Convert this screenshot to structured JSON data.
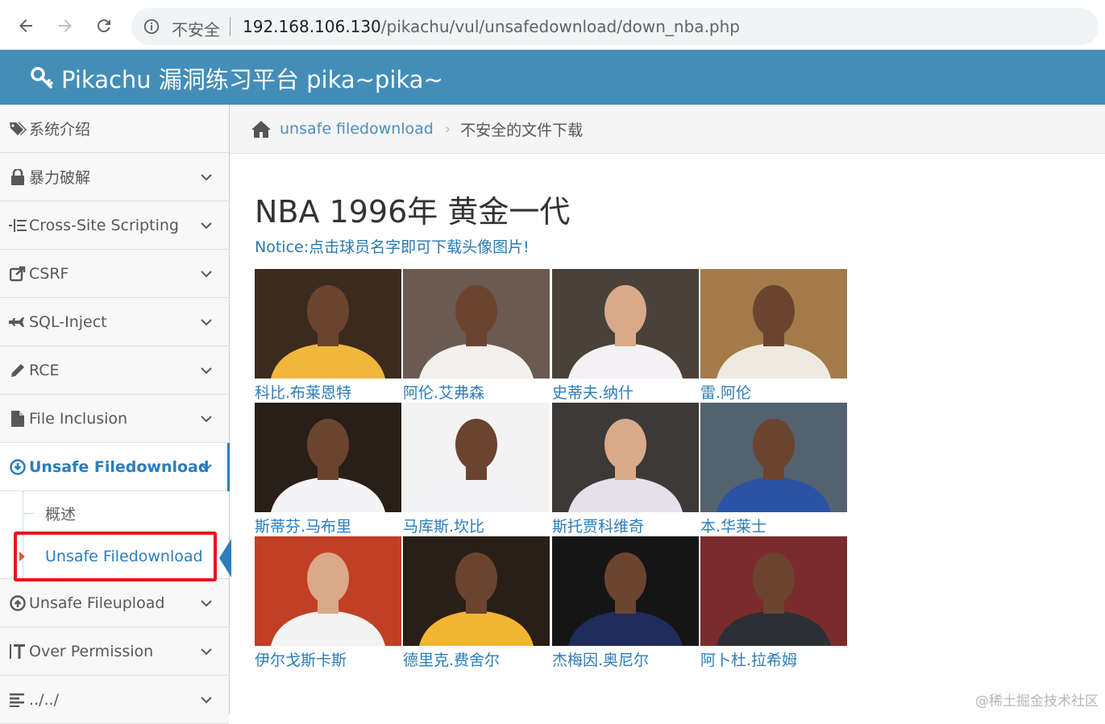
{
  "browser": {
    "insecure_label": "不安全",
    "url_host": "192.168.106.130",
    "url_path": "/pikachu/vul/unsafedownload/down_nba.php"
  },
  "header": {
    "title": "Pikachu 漏洞练习平台 pika~pika~"
  },
  "sidebar": {
    "items": [
      {
        "label": "系统介绍",
        "icon": "tags-icon"
      },
      {
        "label": "暴力破解",
        "icon": "lock-icon"
      },
      {
        "label": "Cross-Site Scripting",
        "icon": "list-icon"
      },
      {
        "label": "CSRF",
        "icon": "share-icon"
      },
      {
        "label": "SQL-Inject",
        "icon": "plane-icon"
      },
      {
        "label": "RCE",
        "icon": "pencil-icon"
      },
      {
        "label": "File Inclusion",
        "icon": "file-icon"
      },
      {
        "label": "Unsafe Filedownload",
        "icon": "download-circle-icon"
      },
      {
        "label": "Unsafe Fileupload",
        "icon": "upload-circle-icon"
      },
      {
        "label": "Over Permission",
        "icon": "text-height-icon"
      },
      {
        "label": "../../",
        "icon": "align-left-icon"
      }
    ],
    "sub_items": [
      {
        "label": "概述"
      },
      {
        "label": "Unsafe Filedownload"
      }
    ]
  },
  "breadcrumb": {
    "link": "unsafe filedownload",
    "current": "不安全的文件下载"
  },
  "main": {
    "title": "NBA 1996年 黄金一代",
    "notice": "Notice:点击球员名字即可下载头像图片!",
    "players": [
      {
        "name": "科比.布莱恩特",
        "bg": "#3a2b1e",
        "jersey": "#f0b73a"
      },
      {
        "name": "阿伦.艾弗森",
        "bg": "#6a5a52",
        "jersey": "#f2efec"
      },
      {
        "name": "史蒂夫.纳什",
        "bg": "#4a4238",
        "jersey": "#f4f1f4"
      },
      {
        "name": "雷.阿伦",
        "bg": "#a37a4a",
        "jersey": "#efeae0"
      },
      {
        "name": "斯蒂芬.马布里",
        "bg": "#2a1e18",
        "jersey": "#f4f4f6"
      },
      {
        "name": "马库斯.坎比",
        "bg": "#f3f3f3",
        "jersey": "#f2f2f6"
      },
      {
        "name": "斯托贾科维奇",
        "bg": "#3b3a38",
        "jersey": "#e6e0ea"
      },
      {
        "name": "本.华莱士",
        "bg": "#54626f",
        "jersey": "#2a53a5"
      },
      {
        "name": "伊尔戈斯卡斯",
        "bg": "#c13f24",
        "jersey": "#f3f3f3"
      },
      {
        "name": "德里克.费舍尔",
        "bg": "#2a1f17",
        "jersey": "#f2b632"
      },
      {
        "name": "杰梅因.奥尼尔",
        "bg": "#151515",
        "jersey": "#1f2c5c"
      },
      {
        "name": "阿卜杜.拉希姆",
        "bg": "#7a2c2c",
        "jersey": "#2c2f34"
      }
    ]
  },
  "watermark": "@稀土掘金技术社区",
  "colors": {
    "header": "#438eb9",
    "link": "#2b7dbc",
    "highlight": "#e8161b"
  }
}
